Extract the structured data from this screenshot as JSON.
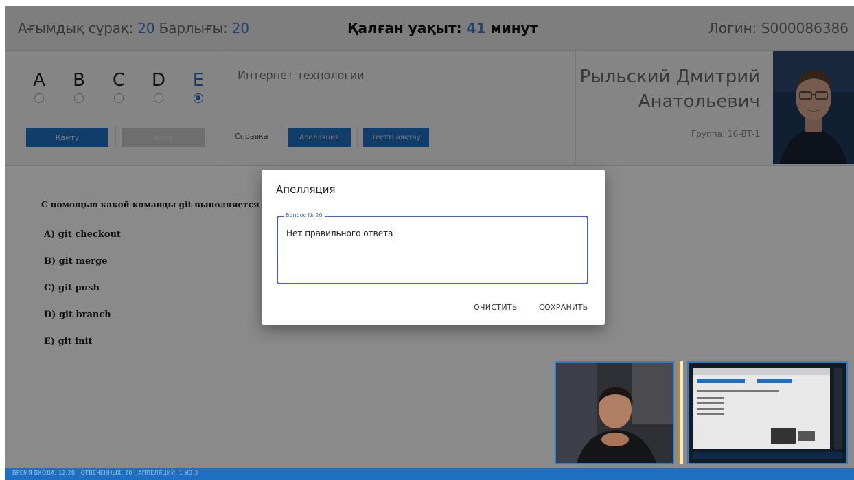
{
  "header": {
    "current_label": "Ағымдық сұрақ:",
    "current_value": "20",
    "total_label": "Барлығы:",
    "total_value": "20",
    "time_label": "Қалған уақыт:",
    "time_value": "41",
    "time_unit": "минут",
    "login_label": "Логин:",
    "login_value": "S000086386"
  },
  "answers_panel": {
    "options": [
      {
        "letter": "A",
        "selected": false
      },
      {
        "letter": "B",
        "selected": false
      },
      {
        "letter": "C",
        "selected": false
      },
      {
        "letter": "D",
        "selected": false
      },
      {
        "letter": "E",
        "selected": true
      }
    ],
    "back_label": "Қайту",
    "next_label": "Алға"
  },
  "subject_panel": {
    "subject": "Интернет технологии",
    "help_label": "Справка",
    "appeal_label": "Апелляция",
    "finish_label": "Тестті аяқтау"
  },
  "student": {
    "name_line1": "Рыльский Дмитрий",
    "name_line2": "Анатольевич",
    "group": "Группа: 16-ВТ-1"
  },
  "question": {
    "text": "С помощью какой команды git выполняется об",
    "answers": [
      "A) git checkout",
      "B) git merge",
      "C) git push",
      "D) git branch",
      "E) git init"
    ]
  },
  "dialog": {
    "title": "Апелляция",
    "field_label": "Вопрос № 20",
    "field_value": "Нет правильного ответа",
    "clear_label": "ОЧИСТИТЬ",
    "save_label": "СОХРАНИТЬ"
  },
  "statusbar": {
    "text": "ВРЕМЯ ВХОДА: 12:28  |  ОТВЕЧЕННЫХ: 20  |  АППЕЛЯЦИЙ: 1 ИЗ 3"
  },
  "colors": {
    "accent": "#1e6fc1",
    "number_blue": "#3a7bbf",
    "dialog_field": "#4a5ec7"
  }
}
